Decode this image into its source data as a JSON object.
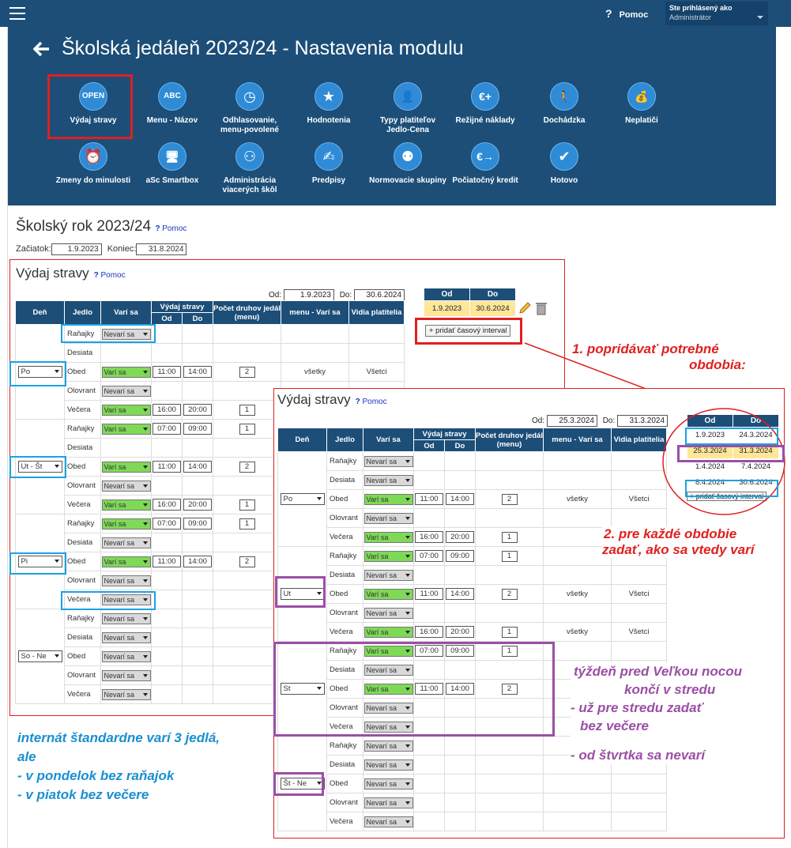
{
  "topbar": {
    "help_label": "Pomoc",
    "user_line1": "Ste prihlásený ako",
    "user_line2": "Administrátor"
  },
  "page_title": "Školská jedáleň 2023/24 - Nastavenia modulu",
  "modules": [
    {
      "label": "Výdaj stravy",
      "icon": "open-sign-icon",
      "glyph": "OPEN"
    },
    {
      "label": "Menu - Názov",
      "icon": "abc-123-icon",
      "glyph": "ABC"
    },
    {
      "label": "Odhlasovanie, menu-povolené",
      "icon": "clock-icon",
      "glyph": "◷"
    },
    {
      "label": "Hodnotenia",
      "icon": "star-icon",
      "glyph": "★"
    },
    {
      "label": "Typy platiteľov Jedlo-Cena",
      "icon": "payer-types-icon",
      "glyph": "👤"
    },
    {
      "label": "Režijné náklady",
      "icon": "euro-plus-icon",
      "glyph": "€+"
    },
    {
      "label": "Dochádzka",
      "icon": "walking-icon",
      "glyph": "🚶"
    },
    {
      "label": "Neplatiči",
      "icon": "money-bag-icon",
      "glyph": "💰"
    },
    {
      "label": "Zmeny do minulosti",
      "icon": "alarm-clock-icon",
      "glyph": "⏰"
    },
    {
      "label": "aSc Smartbox",
      "icon": "monitor-icon",
      "glyph": "🖥"
    },
    {
      "label": "Administrácia viacerých škôl",
      "icon": "org-chart-icon",
      "glyph": "⚇"
    },
    {
      "label": "Predpisy",
      "icon": "handshake-icon",
      "glyph": "✍"
    },
    {
      "label": "Normovacie skupiny",
      "icon": "groups-icon",
      "glyph": "⚉"
    },
    {
      "label": "Počiatočný kredit",
      "icon": "euro-arrow-icon",
      "glyph": "€→"
    },
    {
      "label": "Hotovo",
      "icon": "checkmark-icon",
      "glyph": "✔"
    }
  ],
  "school_year": {
    "title": "Školský rok 2023/24",
    "help": "Pomoc",
    "start_label": "Začiatok:",
    "start": "1.9.2023",
    "end_label": "Koniec:",
    "end": "31.8.2024"
  },
  "headers": {
    "den": "Deň",
    "jedlo": "Jedlo",
    "vari": "Varí sa",
    "vydaj": "Výdaj stravy",
    "od": "Od",
    "do": "Do",
    "pocet": "Počet druhov jedál (menu)",
    "menu": "menu - Varí sa",
    "vidia": "Vidia platitelia"
  },
  "panel1": {
    "title": "Výdaj stravy",
    "help": "Pomoc",
    "od_label": "Od:",
    "od": "1.9.2023",
    "do_label": "Do:",
    "do": "30.6.2024",
    "groups": [
      {
        "day": "Po",
        "rows": [
          {
            "meal": "Raňajky",
            "vari": "Nevarí sa",
            "on": false
          },
          {
            "meal": "Desiata",
            "vari": "",
            "on": false
          },
          {
            "meal": "Obed",
            "vari": "Varí sa",
            "on": true,
            "from": "11:00",
            "to": "14:00",
            "count": "2",
            "menu": "všetky",
            "vidia": "Všetci"
          },
          {
            "meal": "Olovrant",
            "vari": "Nevarí sa",
            "on": false
          },
          {
            "meal": "Večera",
            "vari": "Varí sa",
            "on": true,
            "from": "16:00",
            "to": "20:00",
            "count": "1"
          }
        ]
      },
      {
        "day": "Ut - Št",
        "rows": [
          {
            "meal": "Raňajky",
            "vari": "Varí sa",
            "on": true,
            "from": "07:00",
            "to": "09:00",
            "count": "1"
          },
          {
            "meal": "Desiata",
            "vari": "",
            "on": false
          },
          {
            "meal": "Obed",
            "vari": "Varí sa",
            "on": true,
            "from": "11:00",
            "to": "14:00",
            "count": "2"
          },
          {
            "meal": "Olovrant",
            "vari": "Nevarí sa",
            "on": false
          },
          {
            "meal": "Večera",
            "vari": "Varí sa",
            "on": true,
            "from": "16:00",
            "to": "20:00",
            "count": "1"
          }
        ]
      },
      {
        "day": "Pi",
        "rows": [
          {
            "meal": "Raňajky",
            "vari": "Varí sa",
            "on": true,
            "from": "07:00",
            "to": "09:00",
            "count": "1"
          },
          {
            "meal": "Desiata",
            "vari": "Nevarí sa",
            "on": false
          },
          {
            "meal": "Obed",
            "vari": "Varí sa",
            "on": true,
            "from": "11:00",
            "to": "14:00",
            "count": "2"
          },
          {
            "meal": "Olovrant",
            "vari": "Nevarí sa",
            "on": false
          },
          {
            "meal": "Večera",
            "vari": "Nevarí sa",
            "on": false
          }
        ]
      },
      {
        "day": "So - Ne",
        "rows": [
          {
            "meal": "Raňajky",
            "vari": "Nevarí sa",
            "on": false
          },
          {
            "meal": "Desiata",
            "vari": "Nevarí sa",
            "on": false
          },
          {
            "meal": "Obed",
            "vari": "Nevarí sa",
            "on": false
          },
          {
            "meal": "Olovrant",
            "vari": "Nevarí sa",
            "on": false
          },
          {
            "meal": "Večera",
            "vari": "Nevarí sa",
            "on": false
          }
        ]
      }
    ],
    "intervals": [
      {
        "od": "1.9.2023",
        "do": "30.6.2024"
      }
    ],
    "add_label": "+ pridať časový interval"
  },
  "panel2": {
    "title": "Výdaj stravy",
    "help": "Pomoc",
    "od_label": "Od:",
    "od": "25.3.2024",
    "do_label": "Do:",
    "do": "31.3.2024",
    "groups": [
      {
        "day": "Po",
        "rows": [
          {
            "meal": "Raňajky",
            "vari": "Nevarí sa",
            "on": false
          },
          {
            "meal": "Desiata",
            "vari": "Nevarí sa",
            "on": false
          },
          {
            "meal": "Obed",
            "vari": "Varí sa",
            "on": true,
            "from": "11:00",
            "to": "14:00",
            "count": "2",
            "menu": "všetky",
            "vidia": "Všetci"
          },
          {
            "meal": "Olovrant",
            "vari": "Nevarí sa",
            "on": false
          },
          {
            "meal": "Večera",
            "vari": "Varí sa",
            "on": true,
            "from": "16:00",
            "to": "20:00",
            "count": "1"
          }
        ]
      },
      {
        "day": "Ut",
        "rows": [
          {
            "meal": "Raňajky",
            "vari": "Varí sa",
            "on": true,
            "from": "07:00",
            "to": "09:00",
            "count": "1"
          },
          {
            "meal": "Desiata",
            "vari": "Nevarí sa",
            "on": false
          },
          {
            "meal": "Obed",
            "vari": "Varí sa",
            "on": true,
            "from": "11:00",
            "to": "14:00",
            "count": "2",
            "menu": "všetky",
            "vidia": "Všetci"
          },
          {
            "meal": "Olovrant",
            "vari": "Nevarí sa",
            "on": false
          },
          {
            "meal": "Večera",
            "vari": "Varí sa",
            "on": true,
            "from": "16:00",
            "to": "20:00",
            "count": "1",
            "menu": "všetky",
            "vidia": "Všetci"
          }
        ]
      },
      {
        "day": "St",
        "rows": [
          {
            "meal": "Raňajky",
            "vari": "Varí sa",
            "on": true,
            "from": "07:00",
            "to": "09:00",
            "count": "1"
          },
          {
            "meal": "Desiata",
            "vari": "Nevarí sa",
            "on": false
          },
          {
            "meal": "Obed",
            "vari": "Varí sa",
            "on": true,
            "from": "11:00",
            "to": "14:00",
            "count": "2"
          },
          {
            "meal": "Olovrant",
            "vari": "Nevarí sa",
            "on": false
          },
          {
            "meal": "Večera",
            "vari": "Nevarí sa",
            "on": false
          }
        ]
      },
      {
        "day": "Št - Ne",
        "rows": [
          {
            "meal": "Raňajky",
            "vari": "Nevarí sa",
            "on": false
          },
          {
            "meal": "Desiata",
            "vari": "Nevarí sa",
            "on": false
          },
          {
            "meal": "Obed",
            "vari": "Nevarí sa",
            "on": false
          },
          {
            "meal": "Olovrant",
            "vari": "Nevarí sa",
            "on": false
          },
          {
            "meal": "Večera",
            "vari": "Nevarí sa",
            "on": false
          }
        ]
      }
    ],
    "intervals": [
      {
        "od": "1.9.2023",
        "do": "24.3.2024",
        "hl": false
      },
      {
        "od": "25.3.2024",
        "do": "31.3.2024",
        "hl": true
      },
      {
        "od": "1.4.2024",
        "do": "7.4.2024",
        "hl": false
      },
      {
        "od": "8.4.2024",
        "do": "30.6.2024",
        "hl": false
      }
    ],
    "add_label": "+ pridať časový interval"
  },
  "annotations": {
    "a1_l1": "1. popridávať potrebné",
    "a1_l2": "obdobia:",
    "a2_l1": "2. pre každé obdobie",
    "a2_l2": "zadať, ako sa vtedy varí",
    "a3_l1": "týždeň pred Veľkou nocou",
    "a3_l2": "končí v stredu",
    "a3_l3": "- už pre stredu zadať",
    "a3_l4": "bez večere",
    "a3_l5": "- od štvrtka sa nevarí",
    "a4_l1": "internát štandardne varí 3 jedlá,",
    "a4_l2": "ale",
    "a4_l3": "- v pondelok bez raňajok",
    "a4_l4": "- v piatok bez večere"
  },
  "colors": {
    "navy": "#1c4e78",
    "green": "#7ed957",
    "yellow": "#ffe699",
    "red": "#e02020",
    "cyan": "#1a8fd0",
    "purple": "#9b4fa5"
  }
}
